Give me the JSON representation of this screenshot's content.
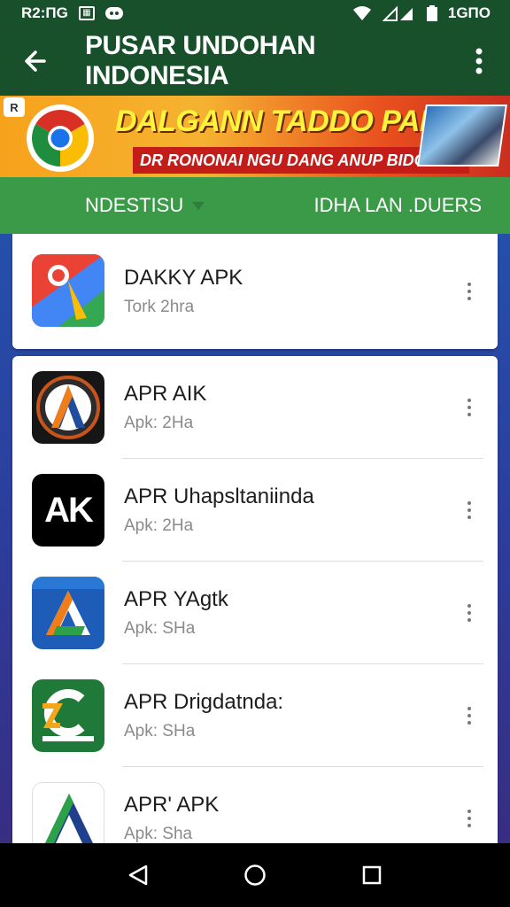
{
  "status_bar": {
    "time": "R2:ПG",
    "right_text": "1GПO",
    "icons": [
      "gallery-icon",
      "chat-icon",
      "wifi-icon",
      "signal-icon",
      "battery-icon"
    ]
  },
  "app_bar": {
    "title": "PUSAR UNDOHAN INDONESIA",
    "back_icon": "arrow-left-icon",
    "menu_icon": "more-vertical-icon"
  },
  "banner": {
    "badge": "R",
    "headline": "DALGANN TADDO PAN!",
    "subline": "DR RONONAI NGU DANG ANUP BIDO VOANUI",
    "colors": {
      "start": "#f7a21b",
      "end": "#c92e1f",
      "headline": "#fff33b",
      "subline_bg": "#c41c18"
    }
  },
  "tabs": {
    "left": "NDESTISU",
    "right": "IDHA LAN .DUERS"
  },
  "apps_featured": [
    {
      "name": "DAKKY APK",
      "meta": "Tork 2hra",
      "icon": "maps-icon"
    }
  ],
  "apps": [
    {
      "name": "APR AIK",
      "meta": "Apk: 2Ha",
      "icon": "emblem-a-icon"
    },
    {
      "name": "APR Uhapsltaniinda",
      "meta": "Apk: 2Ha",
      "icon": "ak-icon"
    },
    {
      "name": "APR YAgtk",
      "meta": "Apk: SHa",
      "icon": "blue-a-icon"
    },
    {
      "name": "APR Drigdatnda:",
      "meta": "Apk: SHa",
      "icon": "green-c-icon"
    },
    {
      "name": "APR' APK",
      "meta": "Apk: Sha",
      "icon": "flag-a-icon"
    }
  ],
  "icon_text": {
    "ak": "AK"
  },
  "nav": [
    "back-icon",
    "home-icon",
    "recents-icon"
  ],
  "colors": {
    "app_bar": "#17502b",
    "tabs": "#3a9a47"
  }
}
